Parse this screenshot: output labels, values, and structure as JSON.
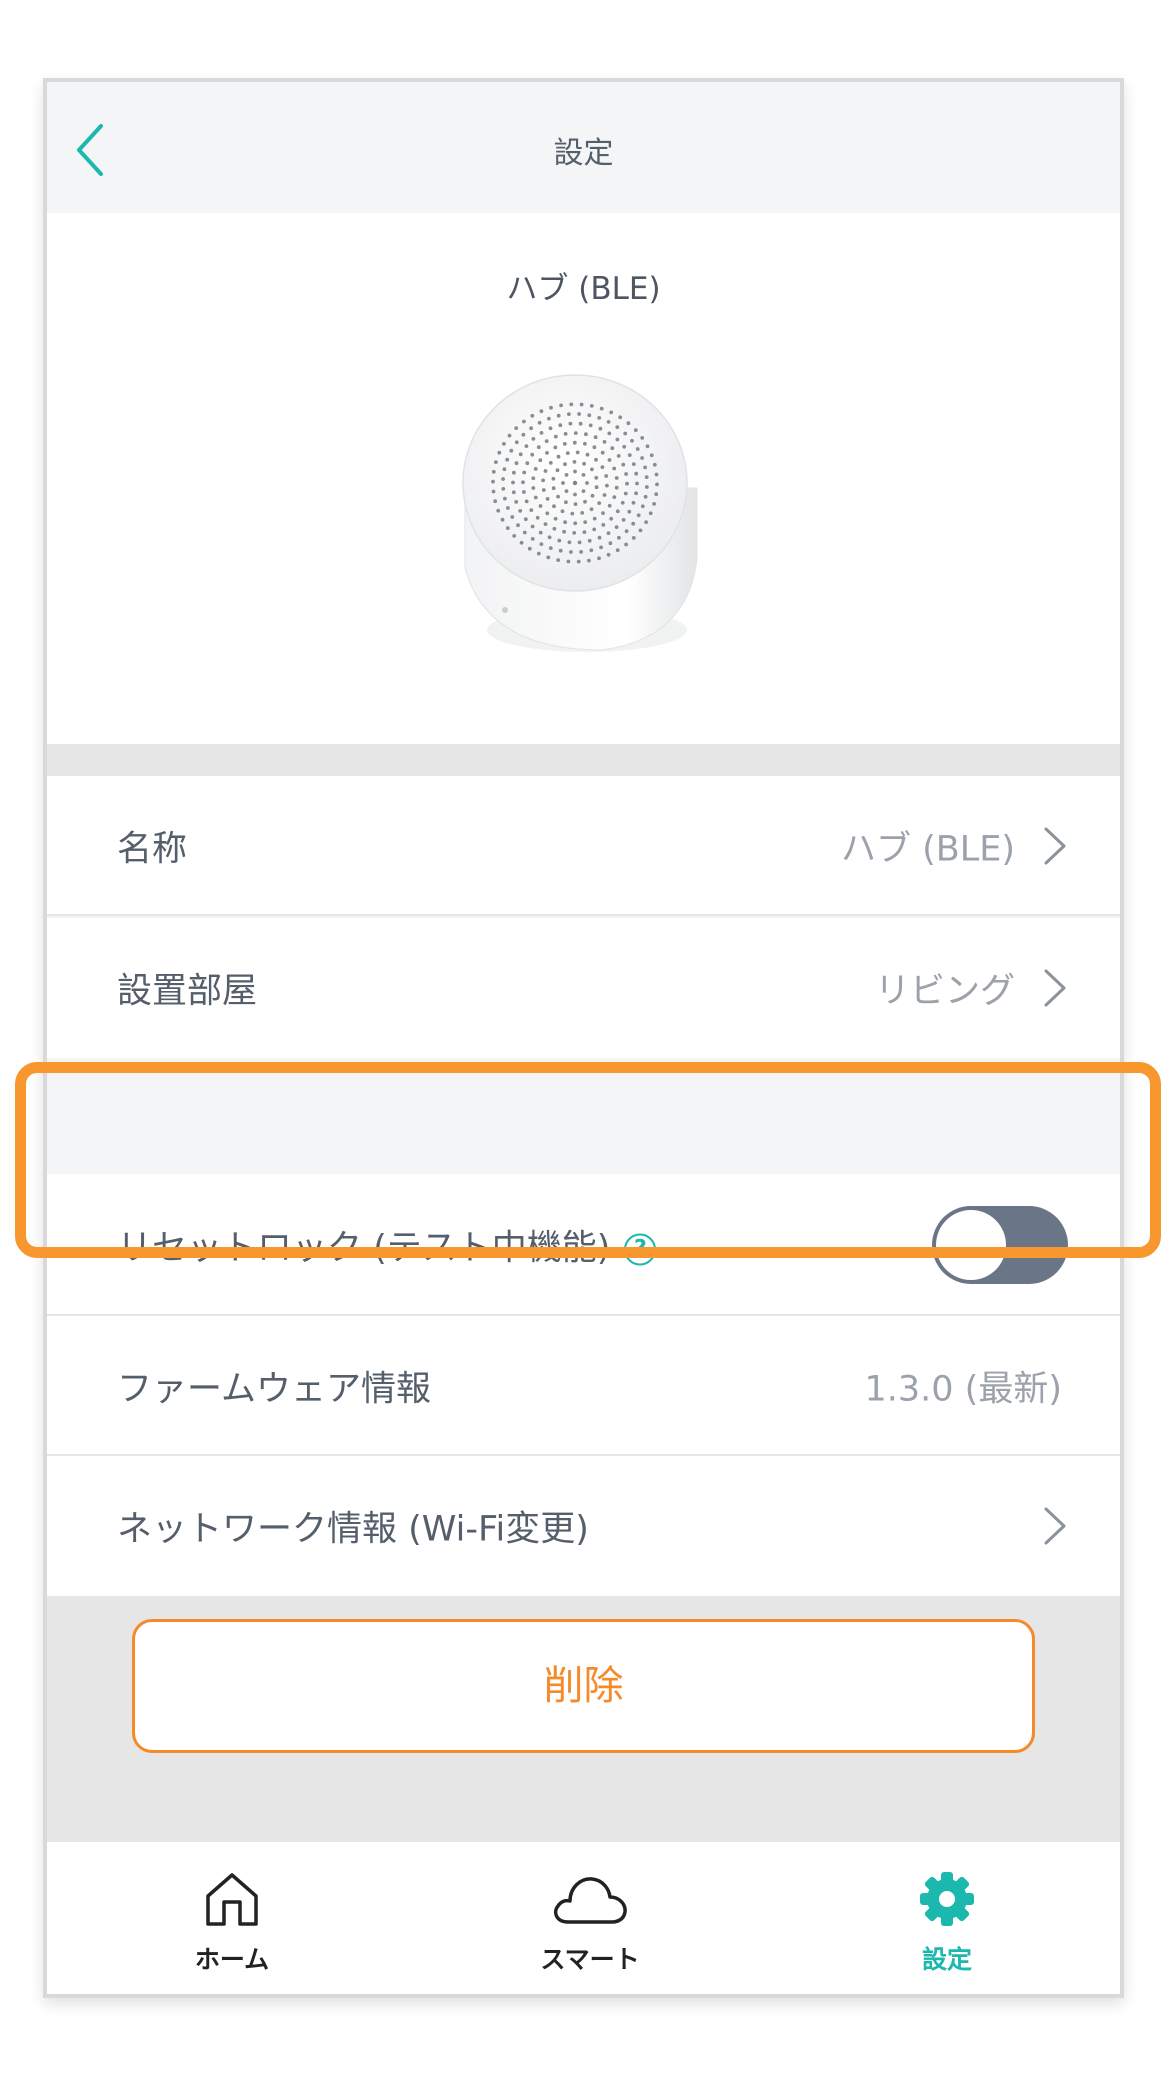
{
  "header": {
    "title": "設定"
  },
  "device": {
    "name": "ハブ (BLE)"
  },
  "settings": {
    "name": {
      "label": "名称",
      "value": "ハブ (BLE)"
    },
    "room": {
      "label": "設置部屋",
      "value": "リビング"
    },
    "reset_lock": {
      "label": "リセットロック (テスト中機能)",
      "help": "?",
      "enabled": false
    },
    "firmware": {
      "label": "ファームウェア情報",
      "value": "1.3.0 (最新)"
    },
    "network": {
      "label": "ネットワーク情報 (Wi-Fi変更)"
    }
  },
  "actions": {
    "delete_label": "削除"
  },
  "tabbar": {
    "home_label": "ホーム",
    "smart_label": "スマート",
    "settings_label": "設定"
  },
  "colors": {
    "accent": "#1bb8ad",
    "danger": "#f58a2a",
    "highlight": "#f7972d",
    "toggle_off": "#6a7588"
  }
}
